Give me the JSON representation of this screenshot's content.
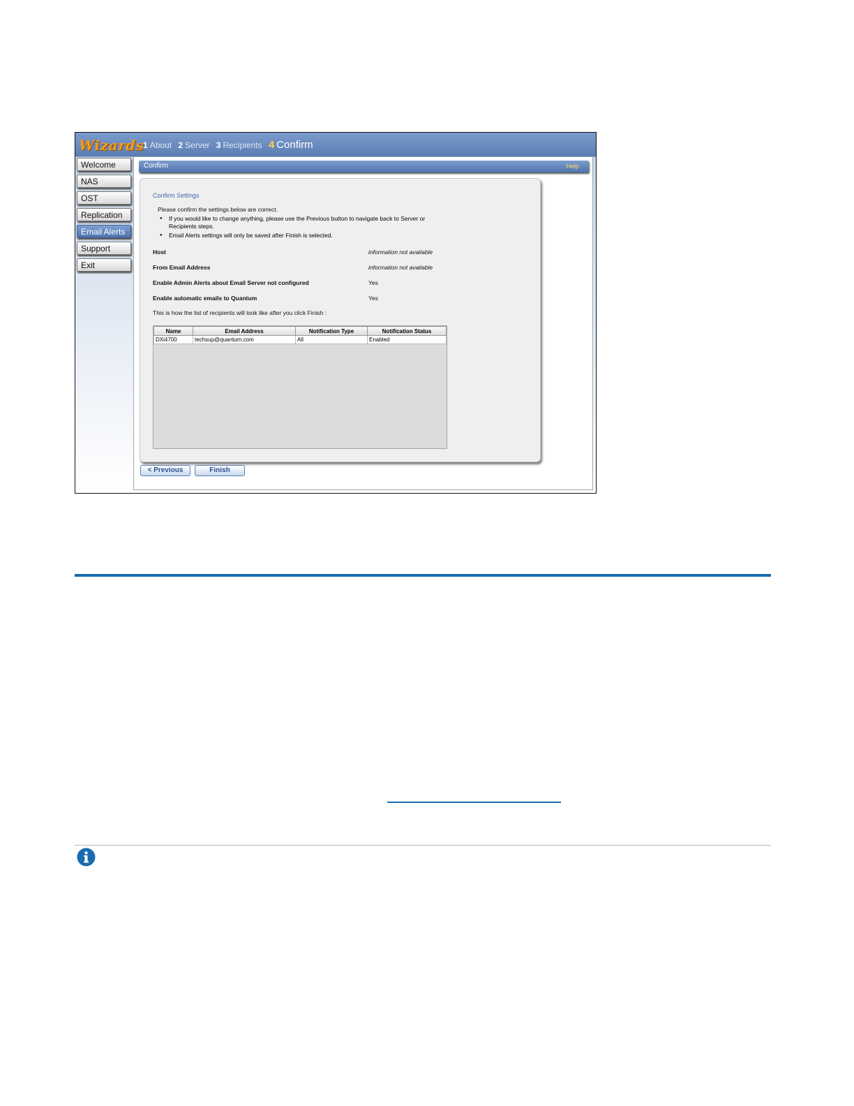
{
  "wizard": {
    "brand": "Wizards",
    "steps": [
      {
        "num": "1",
        "label": "About"
      },
      {
        "num": "2",
        "label": "Server"
      },
      {
        "num": "3",
        "label": "Recipients"
      },
      {
        "num": "4",
        "label": "Confirm"
      }
    ],
    "active_step": "4"
  },
  "sidebar": {
    "items": [
      {
        "label": "Welcome"
      },
      {
        "label": "NAS"
      },
      {
        "label": "OST"
      },
      {
        "label": "Replication"
      },
      {
        "label": "Email Alerts"
      },
      {
        "label": "Support"
      },
      {
        "label": "Exit"
      }
    ],
    "active": "Email Alerts"
  },
  "panel": {
    "title": "Confirm",
    "help": "Help",
    "heading": "Confirm Settings",
    "intro": "Please confirm the settings below are correct.",
    "bullets": [
      "If you would like to change anything, please use the Previous button to navigate back to Server or Recipients steps.",
      "Email Alerts settings will only be saved after Finish is selected."
    ],
    "settings": [
      {
        "label": "Host",
        "value": "information not available"
      },
      {
        "label": "From Email Address",
        "value": "information not available"
      },
      {
        "label": "Enable Admin Alerts about Email Server not configured",
        "value": "Yes"
      },
      {
        "label": "Enable automatic emails to Quantum",
        "value": "Yes"
      }
    ],
    "list_note": "This is how the list of recipients will look like after you click Finish :",
    "table": {
      "headers": [
        "Name",
        "Email Address",
        "Notification Type",
        "Notification Status"
      ],
      "rows": [
        [
          "DXi4700",
          "techsup@quantum.com",
          "All",
          "Enabled"
        ]
      ]
    },
    "buttons": {
      "previous": "< Previous",
      "finish": "Finish"
    }
  },
  "colors": {
    "accent_blue": "#1a6bb0",
    "brand_orange": "#f39a1e",
    "active_step_yellow": "#ffd23a"
  }
}
